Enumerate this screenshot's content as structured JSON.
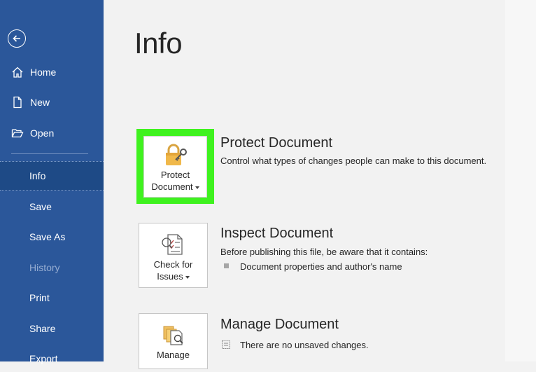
{
  "sidebar": {
    "back_icon": "back-arrow-icon",
    "items": [
      {
        "label": "Home",
        "icon": "home-icon"
      },
      {
        "label": "New",
        "icon": "new-document-icon"
      },
      {
        "label": "Open",
        "icon": "open-folder-icon"
      },
      {
        "label": "Info",
        "active": true
      },
      {
        "label": "Save"
      },
      {
        "label": "Save As"
      },
      {
        "label": "History",
        "disabled": true
      },
      {
        "label": "Print"
      },
      {
        "label": "Share"
      },
      {
        "label": "Export"
      }
    ],
    "background_color": "#2b579a",
    "active_color": "#1e4a86"
  },
  "main": {
    "title": "Info",
    "sections": [
      {
        "tile_label_line1": "Protect",
        "tile_label_line2": "Document",
        "tile_icon": "lock-key-icon",
        "title": "Protect Document",
        "description": "Control what types of changes people can make to this document.",
        "highlight_color": "#3ff21f"
      },
      {
        "tile_label_line1": "Check for",
        "tile_label_line2": "Issues",
        "tile_icon": "inspect-checklist-icon",
        "title": "Inspect Document",
        "description": "Before publishing this file, be aware that it contains:",
        "bullet": "Document properties and author's name"
      },
      {
        "tile_label_line1": "Manage",
        "tile_icon": "manage-document-icon",
        "title": "Manage Document",
        "description": "There are no unsaved changes."
      }
    ]
  }
}
